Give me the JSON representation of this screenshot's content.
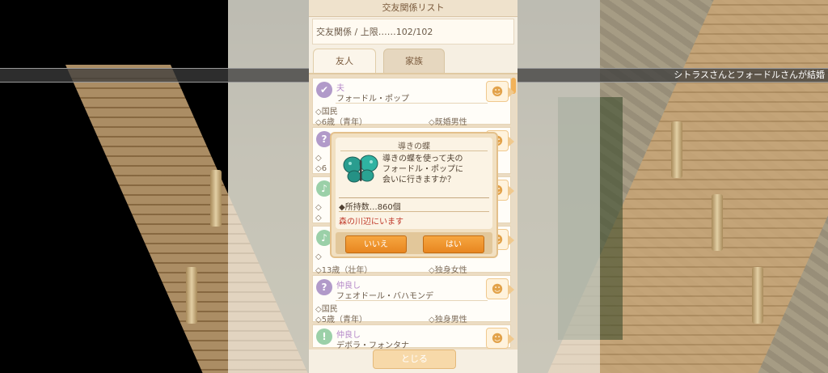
{
  "ticker": {
    "text": "シトラスさんとフォードルさんが結婚"
  },
  "panel": {
    "title": "交友関係リスト",
    "limit_text": "交友関係 / 上限……102/102",
    "tabs": [
      {
        "label": "友人"
      },
      {
        "label": "家族"
      }
    ],
    "close_label": "とじる"
  },
  "entries": [
    {
      "icon_glyph": "✔",
      "relation": "夫",
      "name": "フォードル・ポップ",
      "role": "◇国民",
      "age": "◇6歳（青年）",
      "status": "◇既婚男性"
    },
    {
      "icon_glyph": "?",
      "relation": "",
      "name": "",
      "role": "◇",
      "age": "◇6",
      "status": ""
    },
    {
      "icon_glyph": "♪",
      "relation": "",
      "name": "",
      "role": "◇",
      "age": "◇",
      "status": ""
    },
    {
      "icon_glyph": "♪",
      "relation": "",
      "name": "",
      "role": "◇",
      "age": "◇13歳（壮年）",
      "status": "◇独身女性"
    },
    {
      "icon_glyph": "?",
      "relation": "仲良し",
      "name": "フェオドール・バハモンデ",
      "role": "◇国民",
      "age": "◇5歳（青年）",
      "status": "◇独身男性"
    },
    {
      "icon_glyph": "!",
      "relation": "仲良し",
      "name": "デボラ・フォンタナ",
      "role": "",
      "age": "",
      "status": ""
    }
  ],
  "go_icon": "person-walk-icon",
  "dialog": {
    "title": "導きの蝶",
    "message_lines": [
      "導きの蝶を使って夫の",
      "フォードル・ポップに",
      "会いに行きますか？"
    ],
    "count": "◆所持数…860個",
    "location": "森の川辺にいます",
    "no_label": "いいえ",
    "yes_label": "はい"
  }
}
